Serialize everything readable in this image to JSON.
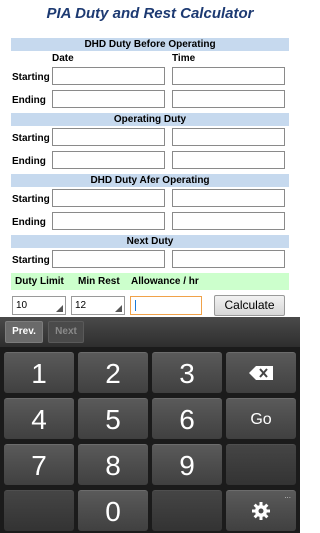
{
  "app": {
    "title": "PIA Duty and Rest Calculator"
  },
  "sections": {
    "dhd_before": "DHD Duty Before Operating",
    "operating": "Operating Duty",
    "dhd_after": "DHD Duty Afer Operating",
    "next": "Next Duty"
  },
  "columns": {
    "date": "Date",
    "time": "Time"
  },
  "labels": {
    "starting": "Starting",
    "ending": "Ending"
  },
  "limits": {
    "duty_limit_label": "Duty Limit",
    "min_rest_label": "Min Rest",
    "allowance_label": "Allowance / hr",
    "duty_limit_value": "10",
    "min_rest_value": "12",
    "allowance_value": ""
  },
  "buttons": {
    "calculate": "Calculate"
  },
  "keyboard": {
    "prev": "Prev.",
    "next": "Next",
    "keys": [
      "1",
      "2",
      "3",
      "4",
      "5",
      "6",
      "7",
      "8",
      "9",
      "0"
    ],
    "go": "Go",
    "backspace_icon": "backspace-icon",
    "settings_icon": "gear-icon",
    "more_indicator": "..."
  }
}
